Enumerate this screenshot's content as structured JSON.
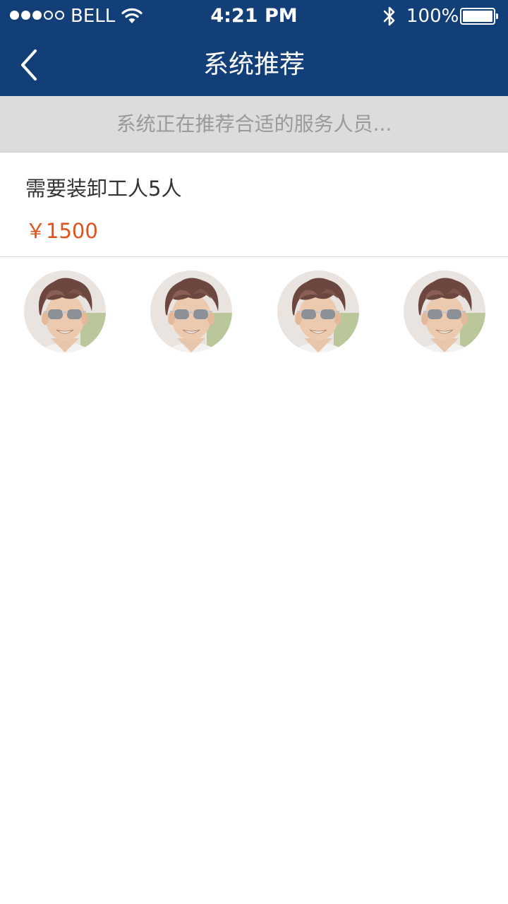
{
  "status_bar": {
    "carrier": "BELL",
    "time": "4:21 PM",
    "battery": "100%",
    "battery_level": 1.0,
    "signal_bars_filled": 3,
    "signal_bars_total": 5,
    "icons": [
      "wifi-icon",
      "bluetooth-icon",
      "battery-icon"
    ]
  },
  "nav": {
    "title": "系统推荐",
    "back_icon": "chevron-left-icon"
  },
  "banner": {
    "text": "系统正在推荐合适的服务人员..."
  },
  "order": {
    "title": "需要装卸工人5人",
    "price": "￥1500"
  },
  "recommended_workers": [
    {
      "avatar": "worker-avatar"
    },
    {
      "avatar": "worker-avatar"
    },
    {
      "avatar": "worker-avatar"
    },
    {
      "avatar": "worker-avatar"
    }
  ],
  "colors": {
    "header": "#133f78",
    "banner_bg": "#dcdcdc",
    "banner_text": "#9a9a9a",
    "price": "#e0521a",
    "title_text": "#333333"
  }
}
